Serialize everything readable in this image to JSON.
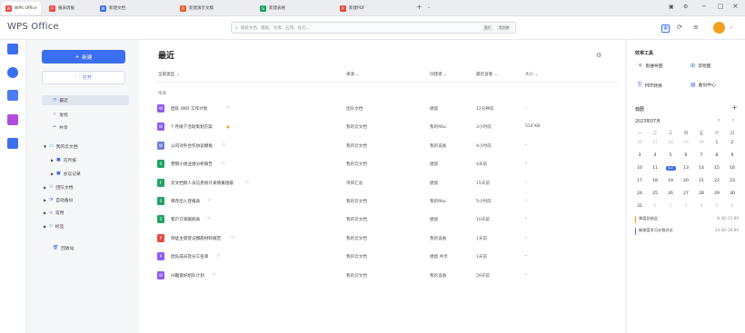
{
  "tabs": [
    {
      "label": "WPS Office",
      "color": "#e94b3c"
    },
    {
      "label": "报表周报",
      "color": "#e94b3c"
    },
    {
      "label": "新建文档",
      "color": "#3a6ff2"
    },
    {
      "label": "新建演示文稿",
      "color": "#e8632b"
    },
    {
      "label": "新建表格",
      "color": "#1fa463"
    },
    {
      "label": "新建PDF",
      "color": "#e94b3c"
    }
  ],
  "header": {
    "logo": "WPS Office",
    "search_placeholder": "搜索文档、模板、文库、应用、技巧...",
    "search_chip1": "图片",
    "search_chip2": "类别库"
  },
  "window": {
    "minimize": "−",
    "restore": "□",
    "close": "×"
  },
  "nav": {
    "new_label": "新建",
    "open_label": "打开",
    "items": [
      {
        "label": "最近",
        "icon": "clock-icon",
        "active": true
      },
      {
        "label": "星标",
        "icon": "star-icon"
      },
      {
        "label": "共享",
        "icon": "share-icon"
      },
      {
        "label": "我的云文档",
        "icon": "folder-icon",
        "expand": true
      },
      {
        "label": "双月报",
        "icon": "folder-icon"
      },
      {
        "label": "会议记录",
        "icon": "folder-icon"
      },
      {
        "label": "团队文档",
        "icon": "team-icon"
      },
      {
        "label": "自动备份",
        "icon": "backup-icon"
      },
      {
        "label": "常用",
        "icon": "link-icon"
      },
      {
        "label": "标签",
        "icon": "tag-icon"
      },
      {
        "label": "回收站",
        "icon": "trash-icon"
      }
    ]
  },
  "main": {
    "title": "最近",
    "columns": {
      "type": "全部类型",
      "source": "来源",
      "creator": "创建者",
      "last_viewed": "最近查看",
      "size": "大小"
    },
    "group_today": "今天",
    "rows": [
      {
        "name": "团队 OKR 工作计划",
        "type": "doc",
        "color": "#8b5cf6",
        "source": "团队文档",
        "creator": "捷督",
        "viewed": "12分钟前",
        "size": "–",
        "star": false
      },
      {
        "name": "7 月线下活动策划方案",
        "type": "doc",
        "color": "#8b5cf6",
        "source": "我的云文档",
        "creator": "我的Mac",
        "viewed": "3小时前",
        "size": "514 KB",
        "star": true
      },
      {
        "name": "公司对外合作协议模板",
        "type": "doc",
        "color": "#6b7fd7",
        "source": "我的云文档",
        "creator": "我的设备",
        "viewed": "4小时前",
        "size": "–",
        "star": false
      },
      {
        "name": "营销小组业绩分析报告",
        "type": "sheet",
        "color": "#1fa463",
        "source": "我的云文档",
        "creator": "捷督",
        "viewed": "4天前",
        "size": "–",
        "star": false
      },
      {
        "name": "云文档新人员信息统计表情报组级",
        "type": "form",
        "color": "#1fa463",
        "source": "项目汇总",
        "creator": "捷督",
        "viewed": "15天前",
        "size": "–",
        "star": false
      },
      {
        "name": "库存出入登报表",
        "type": "sheet",
        "color": "#1fa463",
        "source": "我的云文档",
        "creator": "我的Mac",
        "viewed": "5小时前",
        "size": "–",
        "star": false
      },
      {
        "name": "客户订单跟踪表",
        "type": "sheet",
        "color": "#1fa463",
        "source": "我的云文档",
        "creator": "捷督",
        "viewed": "10天前",
        "size": "–",
        "star": false
      },
      {
        "name": "师徒主席登记摸底材料规范",
        "type": "pdf",
        "color": "#e94b3c",
        "source": "我的云文档",
        "creator": "我的设备",
        "viewed": "1天前",
        "size": "–",
        "star": false
      },
      {
        "name": "团队成员及分工名单",
        "type": "ppt",
        "color": "#8b5cf6",
        "source": "我的云文档",
        "creator": "捷督 共享",
        "viewed": "1天前",
        "size": "–",
        "star": false
      },
      {
        "name": "兴趣爱好组队计划",
        "type": "doc",
        "color": "#8b5cf6",
        "source": "我的云文档",
        "creator": "我的设备",
        "viewed": "29天前",
        "size": "–",
        "star": false
      }
    ]
  },
  "right": {
    "tools_title": "效率工具",
    "tools": [
      {
        "label": "思维导图",
        "icon": "mindmap-icon"
      },
      {
        "label": "流程图",
        "icon": "flowchart-icon"
      },
      {
        "label": "PDF转换",
        "icon": "pdf-icon"
      },
      {
        "label": "备份中心",
        "icon": "backup-icon"
      }
    ],
    "calendar_title": "日历",
    "month": "2023年07月",
    "weekdays": [
      "一",
      "二",
      "三",
      "四",
      "五",
      "六",
      "日"
    ],
    "weeks": [
      [
        "26",
        "27",
        "28",
        "29",
        "30",
        "1",
        "2"
      ],
      [
        "3",
        "4",
        "5",
        "6",
        "7",
        "8",
        "9"
      ],
      [
        "10",
        "11",
        "12",
        "13",
        "14",
        "15",
        "16"
      ],
      [
        "17",
        "18",
        "19",
        "20",
        "21",
        "22",
        "23"
      ],
      [
        "24",
        "25",
        "26",
        "27",
        "28",
        "29",
        "30"
      ],
      [
        "31",
        "1",
        "2",
        "3",
        "4",
        "5",
        "6"
      ]
    ],
    "today": "12",
    "events": [
      {
        "title": "季度总结会",
        "time": "8:30–11:00",
        "color": "#f0a020"
      },
      {
        "title": "新季度学习计划讨论",
        "time": "14:30–16:00",
        "color": "#3a6ff2"
      }
    ]
  }
}
